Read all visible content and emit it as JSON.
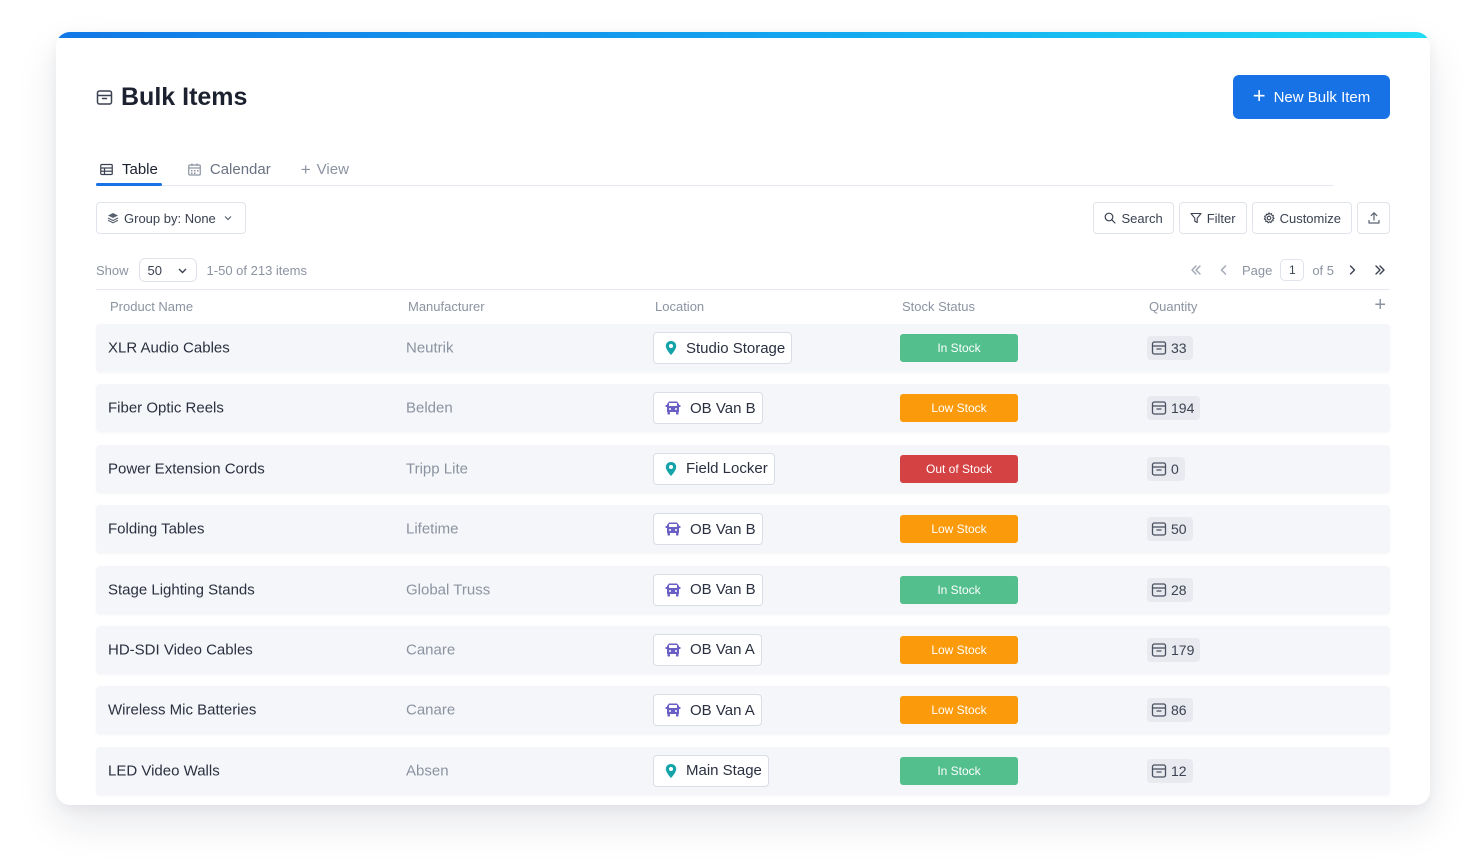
{
  "header": {
    "title": "Bulk Items",
    "new_button_label": "New Bulk Item"
  },
  "tabs": [
    {
      "label": "Table",
      "active": true
    },
    {
      "label": "Calendar",
      "active": false
    },
    {
      "label": "View",
      "active": false
    }
  ],
  "toolbar": {
    "group_by_label": "Group by: None",
    "search_label": "Search",
    "filter_label": "Filter",
    "customize_label": "Customize"
  },
  "pager": {
    "show_label": "Show",
    "page_size": "50",
    "range_text": "1-50 of 213 items",
    "page_label": "Page",
    "current_page": "1",
    "of_text": "of 5"
  },
  "columns": {
    "name": "Product Name",
    "manufacturer": "Manufacturer",
    "location": "Location",
    "stock": "Stock Status",
    "quantity": "Quantity"
  },
  "colors": {
    "accent": "#1672e5",
    "in_stock": "#52bf8d",
    "low_stock": "#fb9a0a",
    "out_of_stock": "#d54244"
  },
  "rows": [
    {
      "name": "XLR Audio Cables",
      "manufacturer": "Neutrik",
      "location": "Studio Storage",
      "location_icon": "map-pin-icon",
      "stock": "In Stock",
      "quantity": "33"
    },
    {
      "name": "Fiber Optic Reels",
      "manufacturer": "Belden",
      "location": "OB Van B",
      "location_icon": "van-icon",
      "stock": "Low Stock",
      "quantity": "194"
    },
    {
      "name": "Power Extension Cords",
      "manufacturer": "Tripp Lite",
      "location": "Field Locker",
      "location_icon": "map-pin-icon",
      "stock": "Out of Stock",
      "quantity": "0"
    },
    {
      "name": "Folding Tables",
      "manufacturer": "Lifetime",
      "location": "OB Van B",
      "location_icon": "van-icon",
      "stock": "Low Stock",
      "quantity": "50"
    },
    {
      "name": "Stage Lighting Stands",
      "manufacturer": "Global Truss",
      "location": "OB Van B",
      "location_icon": "van-icon",
      "stock": "In Stock",
      "quantity": "28"
    },
    {
      "name": "HD-SDI Video Cables",
      "manufacturer": "Canare",
      "location": "OB Van A",
      "location_icon": "van-icon",
      "stock": "Low Stock",
      "quantity": "179"
    },
    {
      "name": "Wireless Mic Batteries",
      "manufacturer": "Canare",
      "location": "OB Van A",
      "location_icon": "van-icon",
      "stock": "Low Stock",
      "quantity": "86"
    },
    {
      "name": "LED Video Walls",
      "manufacturer": "Absen",
      "location": "Main Stage",
      "location_icon": "map-pin-icon",
      "stock": "In Stock",
      "quantity": "12"
    }
  ]
}
